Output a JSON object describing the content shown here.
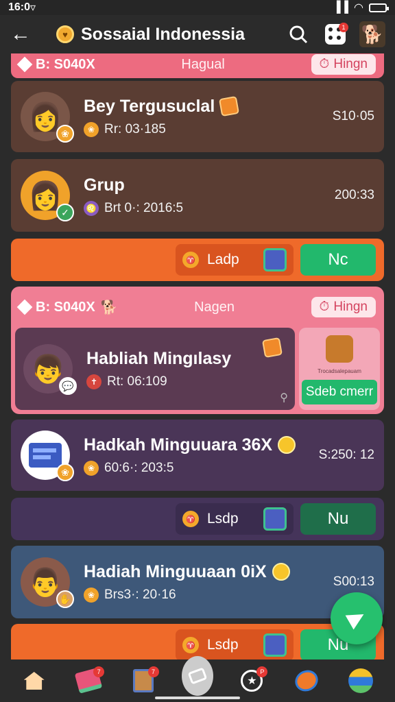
{
  "status_bar": {
    "time": "16:0"
  },
  "app_bar": {
    "title": "Sossaial Indonessia",
    "notif_count": "1"
  },
  "top_head": {
    "code": "B: S040X",
    "mid": "Hagual",
    "pill": "Hingn"
  },
  "rows": [
    {
      "title": "Bey Tergusuclal",
      "sub": "Rr: 03·185",
      "time": "S10·05"
    },
    {
      "title": "Grup",
      "sub": "Brt 0·: 2016:5",
      "time": "200:33"
    }
  ],
  "action_bar_1": {
    "ladp": "Ladp",
    "green": "Nc"
  },
  "hl_card": {
    "code": "B: S040X",
    "mid": "Nagen",
    "pill": "Hingn",
    "title": "Habliah Mingılasy",
    "sub": "Rt: 06:109",
    "side_caption": "Trocadsalepauam",
    "side_btn": "Sdeb cmerr"
  },
  "rows_2": [
    {
      "title": "Hadkah Minguuara 36X",
      "sub": "60:6·: 203:5",
      "time": "S:250: 12"
    }
  ],
  "action_bar_2": {
    "ladp": "Lsdp",
    "green": "Nu"
  },
  "rows_3": [
    {
      "title": "Hadiah Minguuaan 0iX",
      "sub": "Brs3·: 20·16",
      "time": "S00:13"
    }
  ],
  "action_bar_3": {
    "ladp": "Lsdp",
    "green": "Nu"
  },
  "bottom_nav": {
    "badge_1": "7",
    "badge_2": "7",
    "badge_3": "P"
  }
}
